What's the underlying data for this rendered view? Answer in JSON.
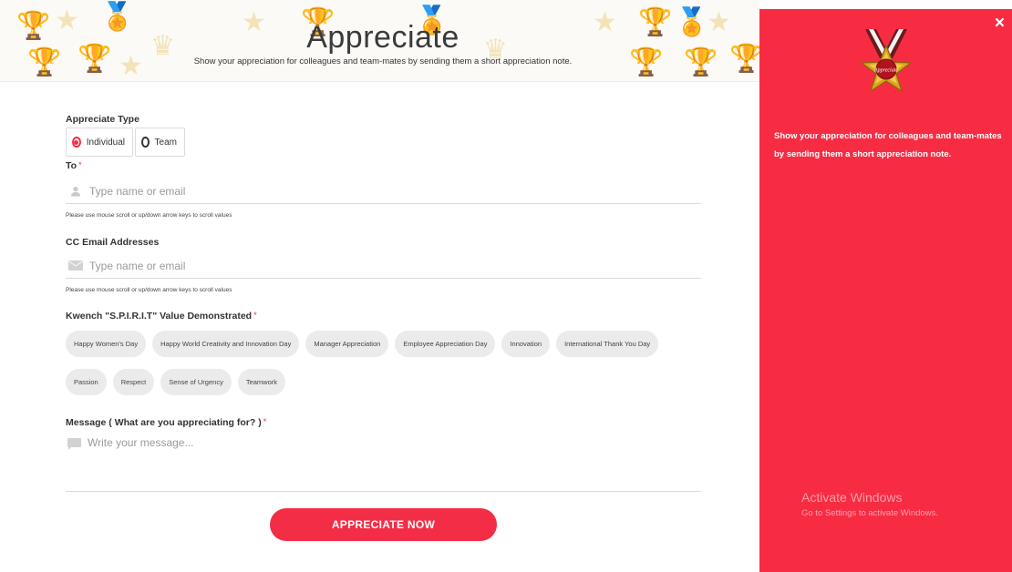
{
  "header": {
    "title": "Appreciate",
    "subtitle": "Show your appreciation for colleagues and team-mates by sending them a short appreciation note."
  },
  "form": {
    "type_label": "Appreciate Type",
    "type_options": [
      {
        "label": "Individual",
        "selected": true
      },
      {
        "label": "Team",
        "selected": false
      }
    ],
    "to_label": "To",
    "to_placeholder": "Type name or email",
    "to_hint": "Please use mouse scroll or up/down arrow keys to scroll values",
    "cc_label": "CC Email Addresses",
    "cc_placeholder": "Type name or email",
    "cc_hint": "Please use mouse scroll or up/down arrow keys to scroll values",
    "values_label": "Kwench \"S.P.I.R.I.T\" Value Demonstrated",
    "values_row1": [
      "Happy Women's Day",
      "Happy World Creativity and Innovation Day",
      "Manager Appreciation",
      "Employee Appreciation Day",
      "Innovation",
      "International Thank You Day"
    ],
    "values_row2": [
      "Passion",
      "Respect",
      "Sense of Urgency",
      "Teamwork"
    ],
    "message_label": "Message ( What are you appreciating for? )",
    "message_placeholder": "Write your message...",
    "required_mark": "*",
    "submit_label": "APPRECIATE NOW"
  },
  "panel": {
    "close_icon": "×",
    "badge_text": "Appreciate",
    "description": "Show your appreciation for colleagues and team-mates by sending them a short appreciation note.",
    "watermark_title": "Activate Windows",
    "watermark_subtitle": "Go to Settings to activate Windows."
  },
  "colors": {
    "accent": "#f32d45",
    "panel_bg": "#f72c43",
    "chip_bg": "#ebebeb"
  }
}
